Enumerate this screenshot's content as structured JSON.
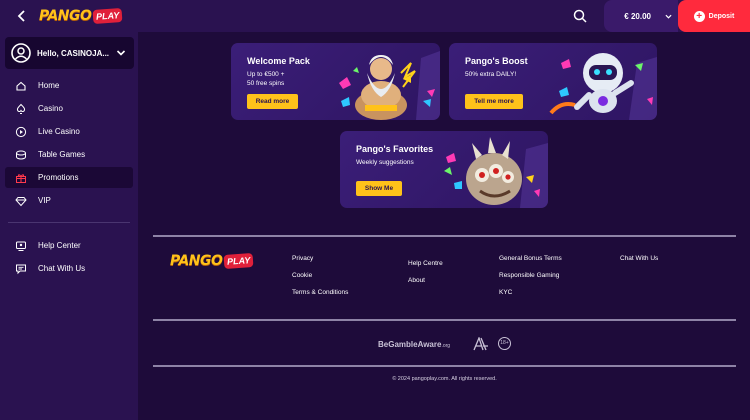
{
  "header": {
    "back_icon": "chevron-left-icon",
    "logo": {
      "word": "PANGO",
      "badge": "PLAY"
    },
    "balance": "€ 20.00",
    "deposit_label": "Deposit"
  },
  "sidebar": {
    "user_label": "Hello, CASINOJA...",
    "items": [
      {
        "label": "Home",
        "icon": "home-icon"
      },
      {
        "label": "Casino",
        "icon": "spade-icon"
      },
      {
        "label": "Live Casino",
        "icon": "play-circle-icon"
      },
      {
        "label": "Table Games",
        "icon": "chips-icon"
      },
      {
        "label": "Promotions",
        "icon": "gift-icon"
      },
      {
        "label": "VIP",
        "icon": "diamond-icon"
      }
    ],
    "support": [
      {
        "label": "Help Center",
        "icon": "help-center-icon"
      },
      {
        "label": "Chat With Us",
        "icon": "chat-icon"
      }
    ]
  },
  "promotions": [
    {
      "title": "Welcome Pack",
      "subtitle_lines": [
        "Up to €500 +",
        "50 free spins"
      ],
      "button": "Read more"
    },
    {
      "title": "Pango's Boost",
      "subtitle_lines": [
        "50% extra DAILY!"
      ],
      "button": "Tell me more"
    },
    {
      "title": "Pango's Favorites",
      "subtitle_lines": [
        "Weekly suggestions"
      ],
      "button": "Show Me"
    }
  ],
  "footer": {
    "col1": [
      "Privacy",
      "Cookie",
      "Terms & Conditions"
    ],
    "col2": [
      "Help Centre",
      "About"
    ],
    "col3": [
      "General Bonus Terms",
      "Responsible Gaming",
      "KYC"
    ],
    "col4": [
      "Chat With Us"
    ],
    "gamble_aware": {
      "main": "BeGambleAware",
      "suffix": ".org"
    },
    "age_badge": "18+",
    "copyright": "© 2024 pangoplay.com. All rights reserved."
  },
  "colors": {
    "background": "#1e0b3a",
    "panel": "#2a1250",
    "accent_yellow": "#ffc21a",
    "deposit_red": "#ff2a3d"
  }
}
